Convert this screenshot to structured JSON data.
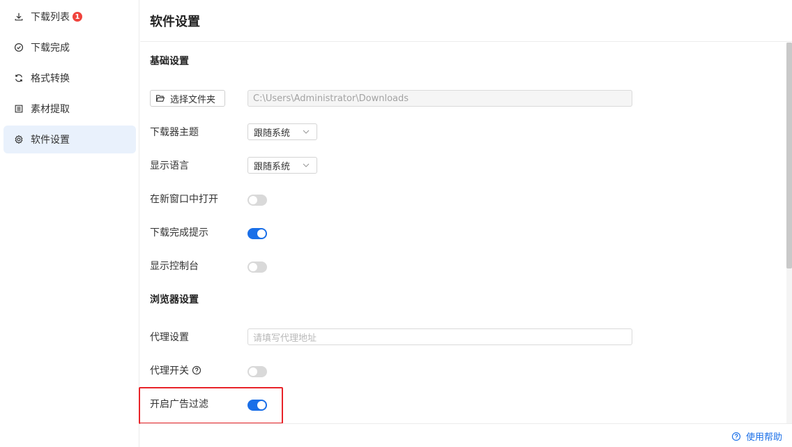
{
  "sidebar": {
    "items": [
      {
        "label": "下载列表",
        "icon": "download-icon",
        "badge": "1"
      },
      {
        "label": "下载完成",
        "icon": "check-circle-icon"
      },
      {
        "label": "格式转换",
        "icon": "refresh-icon"
      },
      {
        "label": "素材提取",
        "icon": "document-icon"
      },
      {
        "label": "软件设置",
        "icon": "gear-icon",
        "active": true
      }
    ]
  },
  "header": {
    "title": "软件设置"
  },
  "basic": {
    "title": "基础设置",
    "folder_button": "选择文件夹",
    "folder_path": "C:\\Users\\Administrator\\Downloads",
    "theme_label": "下载器主题",
    "theme_value": "跟随系统",
    "language_label": "显示语言",
    "language_value": "跟随系统",
    "new_window_label": "在新窗口中打开",
    "new_window_on": false,
    "notify_label": "下载完成提示",
    "notify_on": true,
    "console_label": "显示控制台",
    "console_on": false
  },
  "browser": {
    "title": "浏览器设置",
    "proxy_label": "代理设置",
    "proxy_placeholder": "请填写代理地址",
    "proxy_switch_label": "代理开关",
    "proxy_switch_on": false,
    "adblock_label": "开启广告过滤",
    "adblock_on": true
  },
  "footer": {
    "help_label": "使用帮助"
  },
  "colors": {
    "accent": "#1a6fe8",
    "badge": "#f0433c",
    "highlight": "#e8242a"
  }
}
